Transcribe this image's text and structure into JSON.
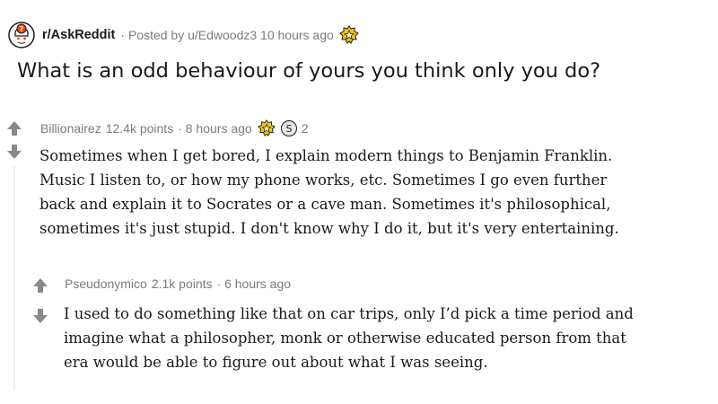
{
  "post": {
    "subreddit": "r/AskReddit",
    "meta": "· Posted by u/Edwoodz3 10 hours ago",
    "title": "What is an odd behaviour of yours you think only you do?"
  },
  "comments": [
    {
      "author": "Billionairez",
      "points": "12.4k points",
      "time": "· 8 hours ago",
      "award_count": "2",
      "lines": [
        "Sometimes when I get bored, I explain modern things to Benjamin Franklin.",
        "Music I listen to, or how my phone works, etc. Sometimes I go even further",
        "back and explain it to Socrates or a cave man. Sometimes it's philosophical,",
        "sometimes it's just stupid. I don't know why I do it, but it's very entertaining."
      ]
    },
    {
      "author": "Pseudonymico",
      "points": "2.1k points",
      "time": "· 6 hours ago",
      "lines": [
        "I used to do something like that on car trips, only I’d pick a time period and",
        "imagine what a philosopher, monk or otherwise educated person from that",
        "era would be able to figure out about what I was seeing."
      ]
    }
  ],
  "icons": {
    "subreddit": "askreddit-icon",
    "award": "gold-award-icon",
    "silver": "silver-award-icon",
    "upvote": "upvote-arrow-icon",
    "downvote": "downvote-arrow-icon"
  },
  "colors": {
    "meta": "#787c7e",
    "arrow": "#878a8c",
    "gold": "#f5c518",
    "text": "#1a1a1b"
  }
}
